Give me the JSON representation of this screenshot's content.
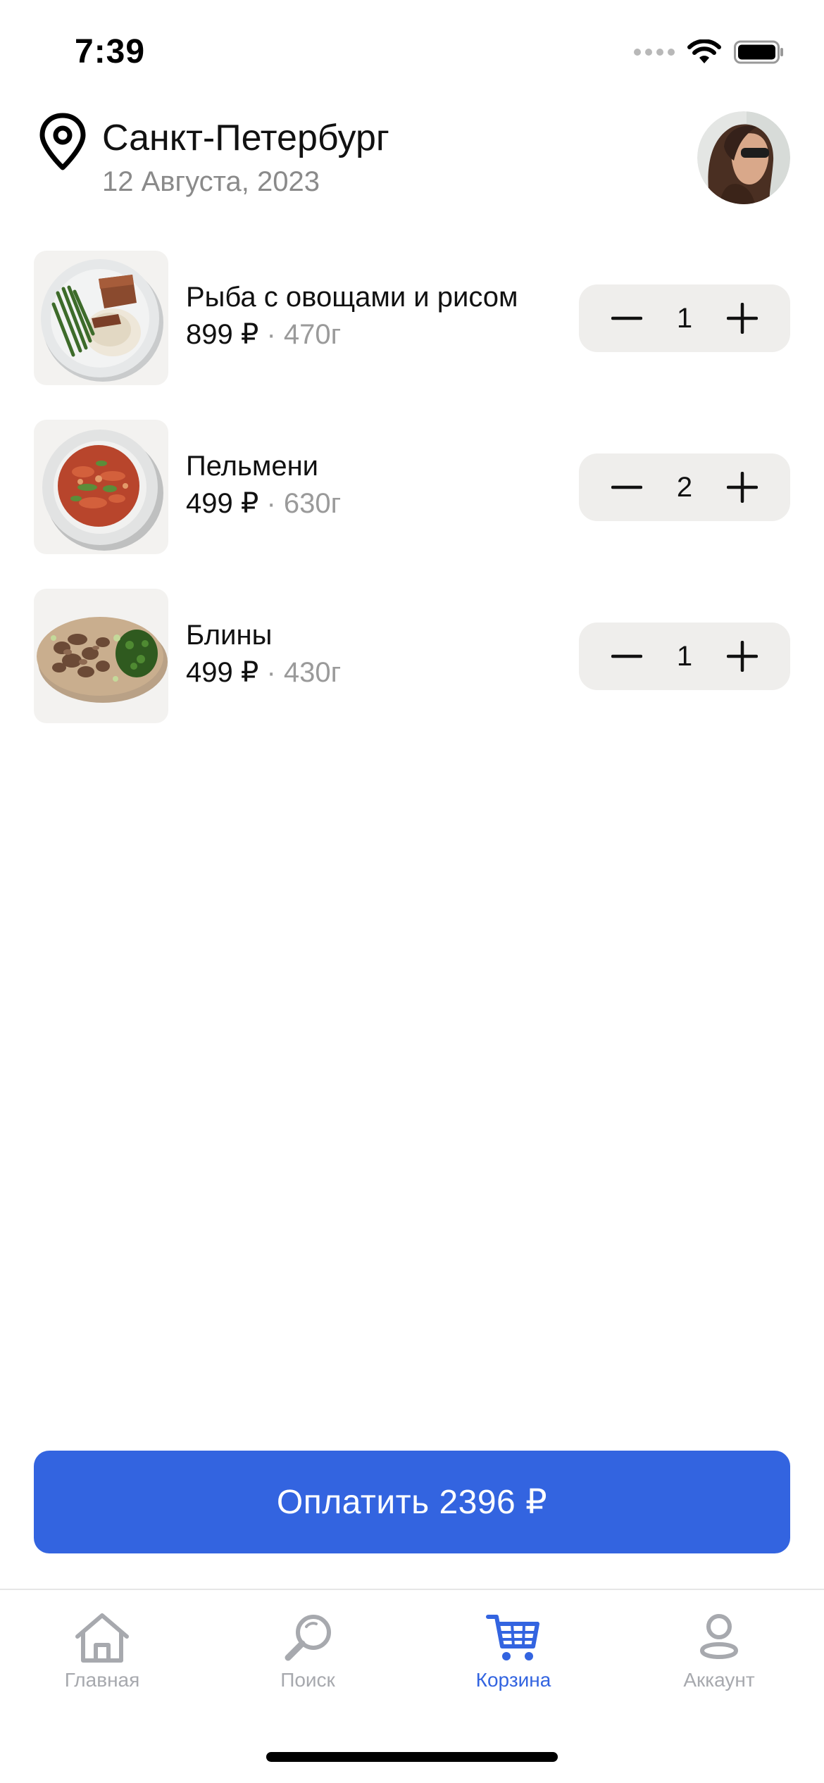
{
  "status_bar": {
    "time": "7:39",
    "icons": [
      "signal-dots-icon",
      "wifi-icon",
      "battery-icon"
    ]
  },
  "header": {
    "city": "Санкт-Петербург",
    "date": "12 Августа, 2023",
    "location_icon": "location-pin-icon",
    "avatar": "user-avatar"
  },
  "cart": {
    "items": [
      {
        "name": "Рыба с овощами и рисом",
        "price": "899 ₽",
        "separator": "·",
        "weight": "470г",
        "quantity": "1"
      },
      {
        "name": "Пельмени",
        "price": "499 ₽",
        "separator": "·",
        "weight": "630г",
        "quantity": "2"
      },
      {
        "name": "Блины",
        "price": "499 ₽",
        "separator": "·",
        "weight": "430г",
        "quantity": "1"
      }
    ]
  },
  "pay_button": {
    "label": "Оплатить 2396 ₽"
  },
  "tab_bar": {
    "tabs": [
      {
        "label": "Главная",
        "icon": "home-icon",
        "active": false
      },
      {
        "label": "Поиск",
        "icon": "search-icon",
        "active": false
      },
      {
        "label": "Корзина",
        "icon": "cart-icon",
        "active": true
      },
      {
        "label": "Аккаунт",
        "icon": "account-icon",
        "active": false
      }
    ]
  },
  "colors": {
    "accent": "#3364e0",
    "tab_inactive": "#a7a9ae",
    "stepper_bg": "#efeeec",
    "secondary_text": "#8a8a8a"
  }
}
